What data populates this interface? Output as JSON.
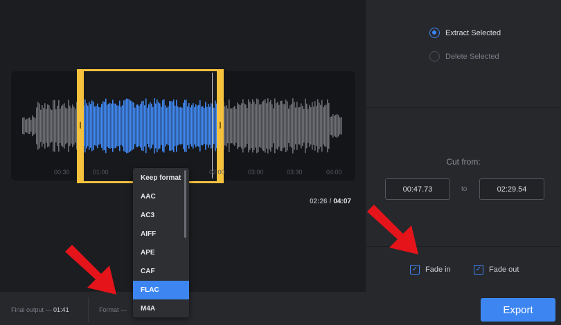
{
  "options": {
    "extract_label": "Extract Selected",
    "delete_label": "Delete Selected",
    "selected": "extract"
  },
  "cut": {
    "label": "Cut from:",
    "from": "00:47.73",
    "to_label": "to",
    "to": "02:29.54"
  },
  "fade": {
    "fade_in_label": "Fade in",
    "fade_in_checked": true,
    "fade_out_label": "Fade out",
    "fade_out_checked": true
  },
  "timeline": {
    "ticks": [
      "00:30",
      "01:00",
      "02:00",
      "03:00",
      "03:30",
      "04:00"
    ],
    "current": "02:26",
    "separator": "/",
    "total": "04:07"
  },
  "bottom": {
    "final_output_label": "Final output —",
    "final_output_value": "01:41",
    "format_label": "Format —",
    "export_label": "Export"
  },
  "format_dropdown": {
    "items": [
      "Keep format",
      "AAC",
      "AC3",
      "AIFF",
      "APE",
      "CAF",
      "FLAC",
      "M4A"
    ],
    "selected": "FLAC"
  },
  "colors": {
    "accent": "#3d86f2",
    "selection": "#f6c23e",
    "arrow": "#e5141b",
    "waveform_grey": "#6e7075"
  }
}
